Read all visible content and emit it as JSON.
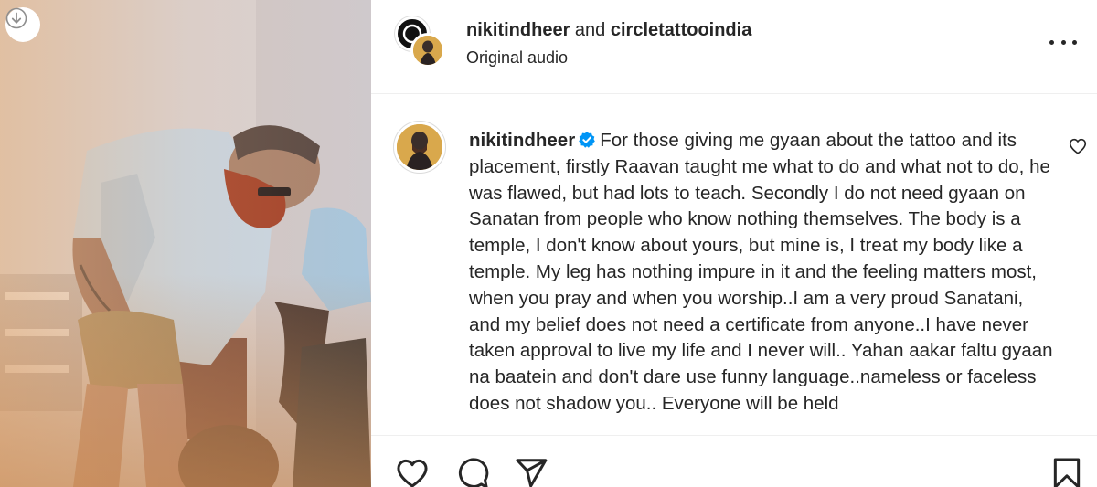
{
  "media": {
    "download_icon": "download-arrow-icon"
  },
  "header": {
    "user1": "nikitindheer",
    "conj": "and",
    "user2": "circletattooindia",
    "audio": "Original audio",
    "more_icon": "more-options-icon"
  },
  "comment": {
    "username": "nikitindheer",
    "verified": true,
    "text": "For those giving me gyaan about the tattoo and its placement, firstly Raavan taught me what to do and what not to do, he was flawed, but had lots to teach. Secondly I do not need gyaan on Sanatan from people who know nothing themselves. The body is a temple, I don't know about yours, but mine is, I treat my body like a temple. My leg has nothing impure in it and the feeling matters most, when you pray and when you worship..I am a very proud Sanatani, and my belief does not need a certificate from anyone..I have never taken approval to live my life and I never will.. Yahan aakar faltu gyaan na baatein and don't dare use funny language..nameless or faceless does not shadow you.. Everyone will be held"
  },
  "actions": {
    "like_icon": "heart-icon",
    "comment_icon": "comment-bubble-icon",
    "share_icon": "paper-plane-icon",
    "save_icon": "bookmark-icon"
  },
  "colors": {
    "text": "#262626",
    "verified": "#0095f6",
    "divider": "#efefef"
  }
}
